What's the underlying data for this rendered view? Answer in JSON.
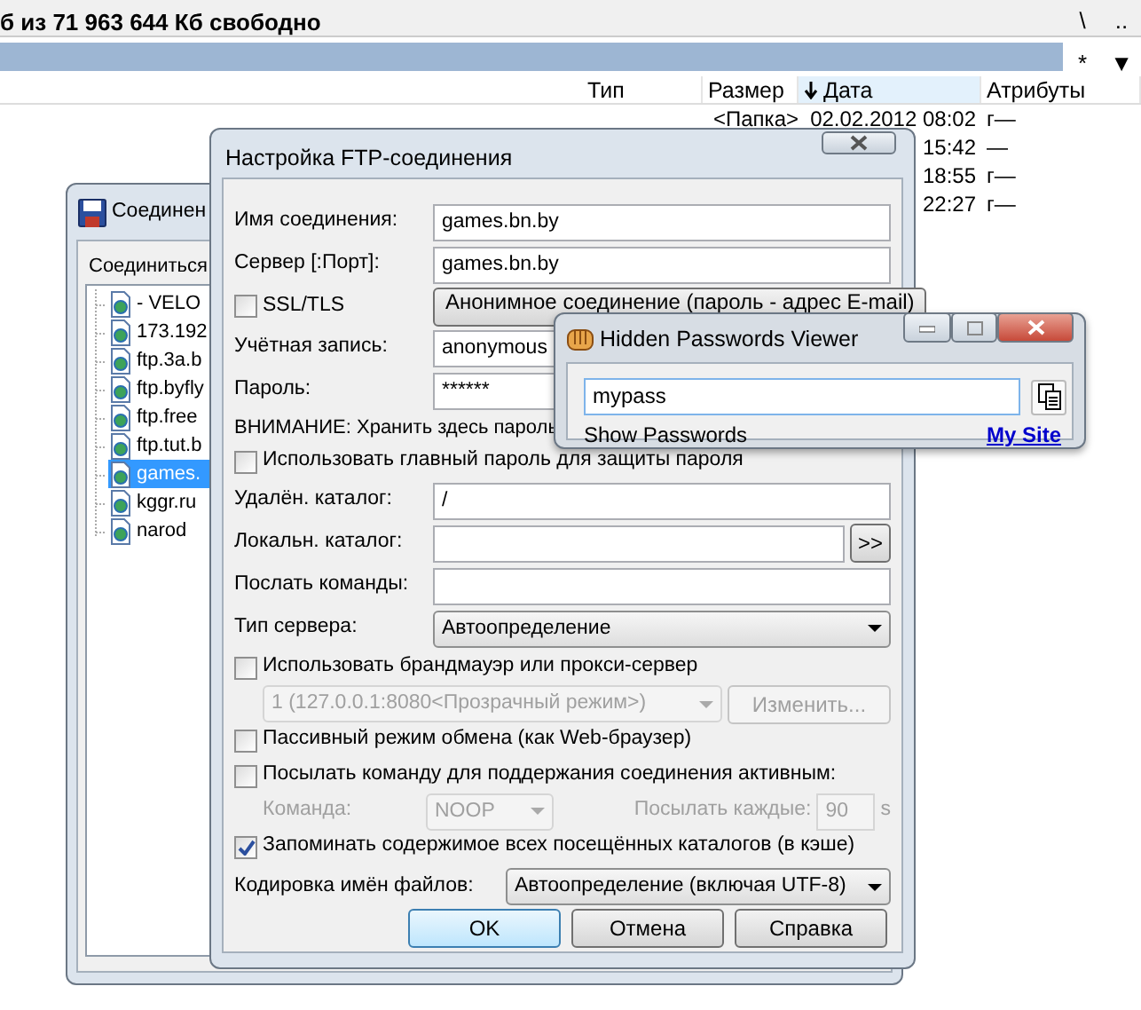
{
  "file_manager": {
    "free_space": "б из 71 963 644 Кб свободно",
    "root_button": "\\",
    "up_button": "..",
    "filter_button": "*",
    "menu_button": "▼",
    "columns": [
      {
        "label": "Тип",
        "sorted": false
      },
      {
        "label": "Размер",
        "sorted": false
      },
      {
        "label": "Дата",
        "sorted": true
      },
      {
        "label": "Атрибуты",
        "sorted": false
      }
    ],
    "rows": [
      {
        "size": "<Папка>",
        "date": "02.02.2012 08:02",
        "attributes": "г—"
      },
      {
        "date": "15:42",
        "attributes": "—"
      },
      {
        "date": "18:55",
        "attributes": "г—"
      },
      {
        "date": "22:27",
        "attributes": "г—"
      }
    ]
  },
  "connections_window": {
    "title": "Соединен",
    "label": "Соединиться",
    "tree": [
      {
        "label": "- VELO",
        "selected": false
      },
      {
        "label": "173.192",
        "selected": false
      },
      {
        "label": "ftp.3a.b",
        "selected": false
      },
      {
        "label": "ftp.byfly",
        "selected": false
      },
      {
        "label": "ftp.free",
        "selected": false
      },
      {
        "label": "ftp.tut.b",
        "selected": false
      },
      {
        "label": "games.",
        "selected": true
      },
      {
        "label": "kggr.ru",
        "selected": false
      },
      {
        "label": "narod",
        "selected": false
      }
    ]
  },
  "ftp_dialog": {
    "title": "Настройка FTP-соединения",
    "rows": [
      {
        "kind": "field",
        "label": "Имя соединения:",
        "value": "games.bn.by"
      },
      {
        "kind": "field",
        "label": "Сервер [:Порт]:",
        "value": "games.bn.by"
      },
      {
        "kind": "check_button",
        "label": "SSL/TLS",
        "checked": false,
        "button": "Анонимное соединение (пароль - адрес E-mail)"
      },
      {
        "kind": "field",
        "label": "Учётная запись:",
        "value": "anonymous"
      },
      {
        "kind": "field",
        "label": "Пароль:",
        "value": "******"
      },
      {
        "kind": "note",
        "label": "ВНИМАНИЕ: Хранить здесь пароль"
      },
      {
        "kind": "checkbox",
        "label": "Использовать главный пароль для защиты пароля",
        "checked": false
      },
      {
        "kind": "field",
        "label": "Удалён. каталог:",
        "value": "/"
      },
      {
        "kind": "browse",
        "label": "Локальн. каталог:",
        "button": ">>"
      },
      {
        "kind": "field",
        "label": "Послать команды:"
      },
      {
        "kind": "select",
        "label": "Тип сервера:",
        "value": "Автоопределение"
      },
      {
        "kind": "checkbox",
        "label": "Использовать брандмауэр или прокси-сервер",
        "checked": false
      },
      {
        "kind": "proxy",
        "value": "1 (127.0.0.1:8080<Прозрачный режим>)",
        "button": "Изменить...",
        "disabled": true
      },
      {
        "kind": "checkbox",
        "label": "Пассивный режим обмена (как Web-браузер)",
        "checked": false
      },
      {
        "kind": "checkbox",
        "label": "Посылать команду для поддержания соединения активным:",
        "checked": false
      },
      {
        "kind": "keepalive",
        "label": "Команда:",
        "value": "NOOP",
        "interval_label": "Посылать каждые:",
        "interval": "90",
        "unit": "s",
        "disabled": true
      },
      {
        "kind": "checkbox",
        "label": "Запоминать содержимое всех посещённых каталогов (в кэше)",
        "checked": true
      },
      {
        "kind": "encoding",
        "label": "Кодировка имён файлов:",
        "value": "Автоопределение (включая UTF-8)"
      }
    ],
    "buttons": [
      {
        "label": "OK",
        "default": true
      },
      {
        "label": "Отмена",
        "default": false
      },
      {
        "label": "Справка",
        "default": false
      }
    ]
  },
  "hpv_window": {
    "title": "Hidden Passwords Viewer",
    "password": "mypass",
    "show_label": "Show Passwords",
    "link": "My Site"
  }
}
